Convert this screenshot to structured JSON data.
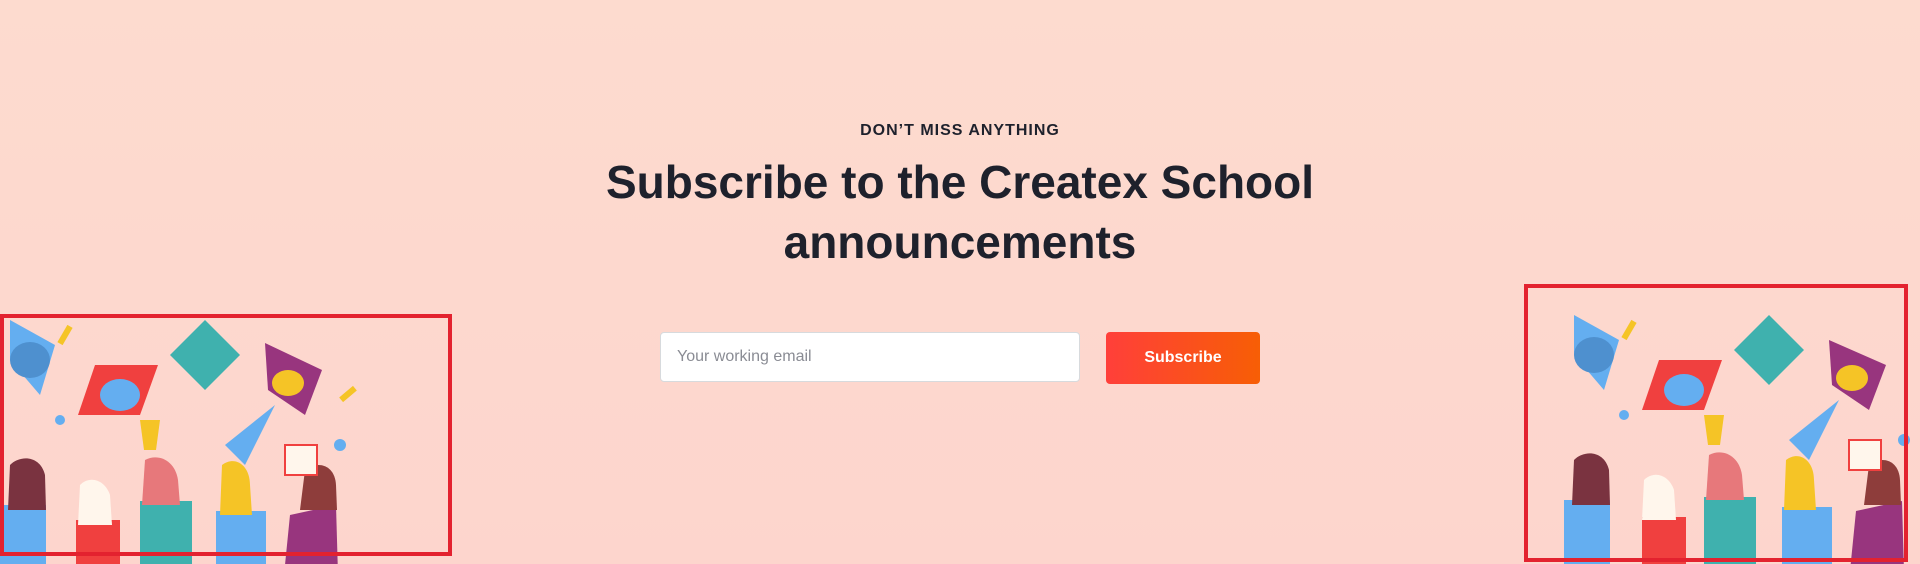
{
  "subscribe": {
    "eyebrow": "DON’T MISS ANYTHING",
    "title": "Subscribe to the Createx School announcements",
    "email_placeholder": "Your working email",
    "button_label": "Subscribe"
  },
  "colors": {
    "background": "#fddbcf",
    "heading": "#1e212c",
    "button_gradient_start": "#ff3f3a",
    "button_gradient_end": "#f75e05",
    "frame": "#e3222f"
  }
}
